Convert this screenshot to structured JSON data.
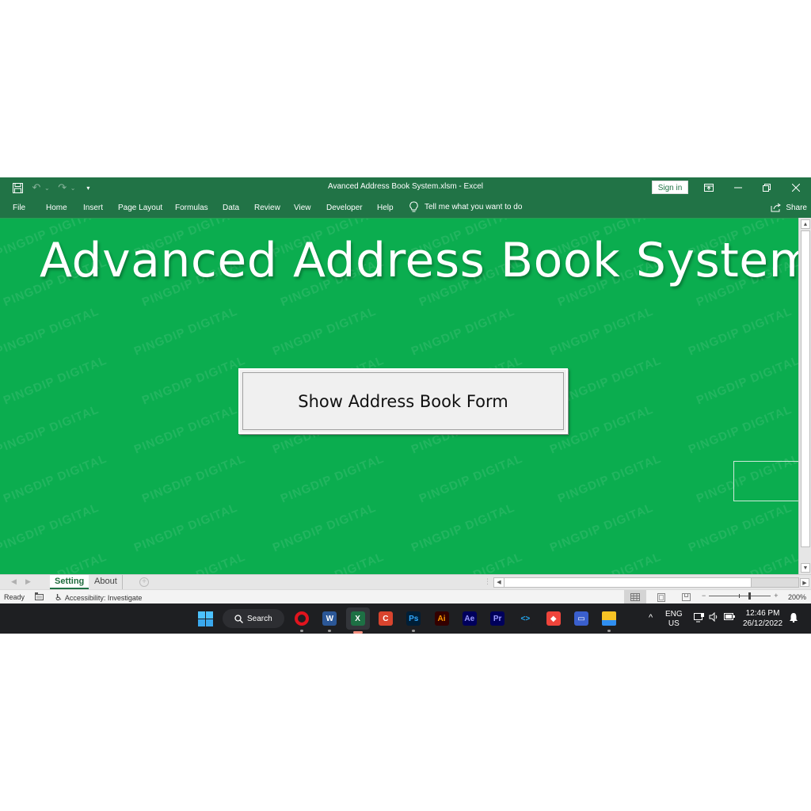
{
  "window": {
    "title": "Avanced Address Book System.xlsm  -  Excel",
    "sign_in_label": "Sign in",
    "share_label": "Share"
  },
  "qat": {
    "icons": [
      "save-icon",
      "undo-icon",
      "redo-icon",
      "customize-qat-icon"
    ]
  },
  "ribbon": {
    "tabs": [
      "File",
      "Home",
      "Insert",
      "Page Layout",
      "Formulas",
      "Data",
      "Review",
      "View",
      "Developer",
      "Help"
    ],
    "tell_me": "Tell me what you want to do"
  },
  "sheet": {
    "heading": "Advanced Address Book System",
    "button_label": "Show Address Book Form",
    "watermark": "PINGDIP DIGITAL",
    "background_color": "#0bad4f"
  },
  "sheet_tabs": {
    "tabs": [
      {
        "label": "Setting",
        "active": true
      },
      {
        "label": "About",
        "active": false
      }
    ],
    "add_label": "+"
  },
  "status_bar": {
    "ready": "Ready",
    "accessibility": "Accessibility: Investigate",
    "zoom_minus": "−",
    "zoom_plus": "+",
    "zoom_level": "200%"
  },
  "taskbar": {
    "search_label": "Search",
    "apps": [
      {
        "name": "opera",
        "label": "O",
        "color": "#e0141e",
        "running": true
      },
      {
        "name": "word",
        "label": "W",
        "color": "#2b5797",
        "running": true
      },
      {
        "name": "excel",
        "label": "X",
        "color": "#1d7044",
        "running": true,
        "active": true
      },
      {
        "name": "ccleaner",
        "label": "C",
        "color": "#d9442e",
        "running": false
      },
      {
        "name": "photoshop",
        "label": "Ps",
        "color": "#001e36",
        "text_color": "#31a8ff",
        "running": true
      },
      {
        "name": "illustrator",
        "label": "Ai",
        "color": "#330000",
        "text_color": "#ff9a00",
        "running": false
      },
      {
        "name": "after-effects",
        "label": "Ae",
        "color": "#00005b",
        "text_color": "#9999ff",
        "running": false
      },
      {
        "name": "premiere",
        "label": "Pr",
        "color": "#00005b",
        "text_color": "#9999ff",
        "running": false
      },
      {
        "name": "vscode",
        "label": "<>",
        "color": "#1e1f22",
        "text_color": "#23a9f2",
        "running": false
      },
      {
        "name": "anydesk",
        "label": "◆",
        "color": "#ef443b",
        "running": false
      },
      {
        "name": "scanner",
        "label": "▭",
        "color": "#3a5fcd",
        "running": false
      },
      {
        "name": "file-explorer",
        "label": "",
        "color": "#f7c325",
        "running": true
      }
    ],
    "language_line1": "ENG",
    "language_line2": "US",
    "time": "12:46 PM",
    "date": "26/12/2022"
  }
}
